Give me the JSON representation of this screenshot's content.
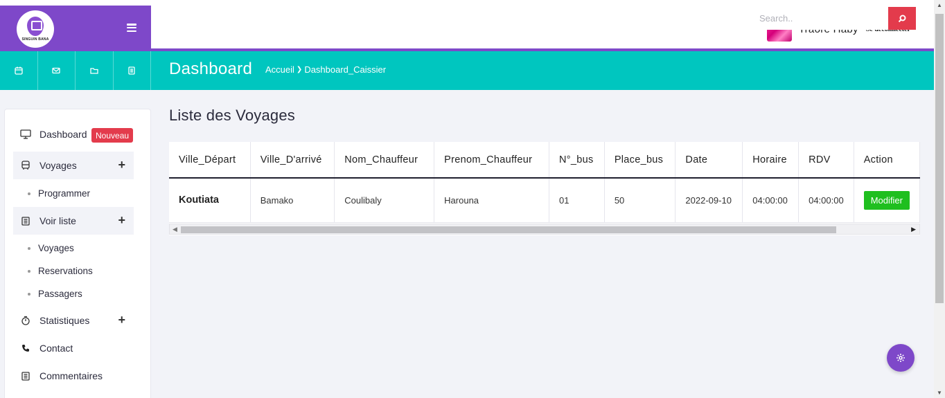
{
  "header": {
    "logo_text": "SINGUIN BANA",
    "user_name": "Traoré Haby",
    "logout_label": "Se déconnecter"
  },
  "quick_icons": [
    "calendar-icon",
    "envelope-icon",
    "folder-icon",
    "document-icon"
  ],
  "topbar": {
    "page_title": "Dashboard",
    "breadcrumb": [
      "Accueil",
      "Dashboard_Caissier"
    ],
    "search_placeholder": "Search..",
    "accent": "#00c6bf",
    "brand_color": "#7e48c9",
    "danger_color": "#e33b4c"
  },
  "sidebar": {
    "dashboard": "Dashboard",
    "badge": "Nouveau",
    "voyages": "Voyages",
    "programmer": "Programmer",
    "voir_liste": "Voir liste",
    "sub_voyages": "Voyages",
    "reservations": "Reservations",
    "passagers": "Passagers",
    "statistiques": "Statistiques",
    "contact": "Contact",
    "commentaires": "Commentaires",
    "plus": "+"
  },
  "main": {
    "title": "Liste des Voyages",
    "columns": [
      "Ville_Départ",
      "Ville_D'arrivé",
      "Nom_Chauffeur",
      "Prenom_Chauffeur",
      "N°_bus",
      "Place_bus",
      "Date",
      "Horaire",
      "RDV",
      "Action"
    ],
    "rows": [
      {
        "ville_depart": "Koutiata",
        "ville_arrivee": "Bamako",
        "nom": "Coulibaly",
        "prenom": "Harouna",
        "bus": "01",
        "places": "50",
        "date": "2022-09-10",
        "horaire": "04:00:00",
        "rdv": "04:00:00",
        "action": "Modifier"
      }
    ]
  }
}
